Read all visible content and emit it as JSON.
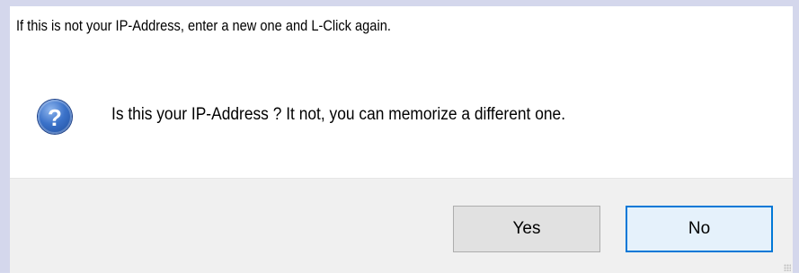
{
  "dialog": {
    "instruction_text": "If this is not your IP-Address, enter a new one and L-Click again.",
    "question_text": "Is this your IP-Address ? It not, you can memorize a different one.",
    "icon": "question-icon",
    "icon_glyph": "?"
  },
  "buttons": {
    "yes_label": "Yes",
    "no_label": "No"
  },
  "colors": {
    "background_frame": "#d4d7ec",
    "dialog_background": "#ffffff",
    "button_bar_background": "#f0f0f0",
    "default_button_border": "#0078d7",
    "icon_blue": "#3b72c9"
  }
}
